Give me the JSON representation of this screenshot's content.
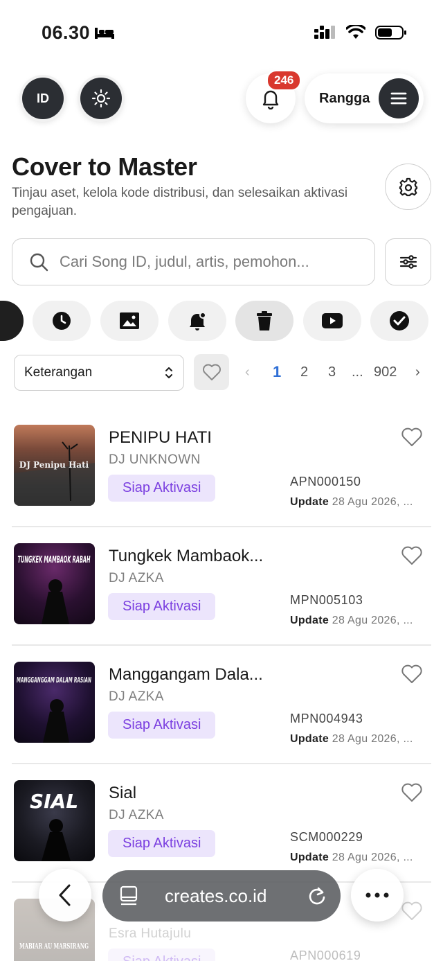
{
  "status_bar": {
    "time": "06.30"
  },
  "header": {
    "language_label": "ID",
    "notification_count": "246",
    "user_name": "Rangga"
  },
  "page": {
    "title": "Cover to Master",
    "subtitle": "Tinjau aset, kelola kode distribusi, dan selesaikan aktivasi pengajuan."
  },
  "search": {
    "placeholder": "Cari Song ID, judul, artis, pemohon..."
  },
  "filter_chips": [
    {
      "icon": "clock-icon"
    },
    {
      "icon": "image-icon"
    },
    {
      "icon": "bell-alert-icon"
    },
    {
      "icon": "trash-icon",
      "active": true
    },
    {
      "icon": "youtube-icon"
    },
    {
      "icon": "check-circle-icon"
    }
  ],
  "sort": {
    "selected": "Keterangan"
  },
  "pagination": {
    "prev": "‹",
    "pages": [
      "1",
      "2",
      "3"
    ],
    "ellipsis": "...",
    "last": "902",
    "next": "›",
    "current": "1"
  },
  "songs": [
    {
      "title": "PENIPU HATI",
      "artist": "DJ UNKNOWN",
      "status": "Siap Aktivasi",
      "code": "APN000150",
      "update_label": "Update",
      "update_value": "28 Agu 2026, ...",
      "cover_text": "DJ Penipu Hati"
    },
    {
      "title": "Tungkek Mambaok...",
      "artist": "DJ AZKA",
      "status": "Siap Aktivasi",
      "code": "MPN005103",
      "update_label": "Update",
      "update_value": "28 Agu 2026, ...",
      "cover_text": "TUNGKEK MAMBAOK RABAH"
    },
    {
      "title": "Manggangam Dala...",
      "artist": "DJ AZKA",
      "status": "Siap Aktivasi",
      "code": "MPN004943",
      "update_label": "Update",
      "update_value": "28 Agu 2026, ...",
      "cover_text": "MANGGANGGAM DALAM RASIAN"
    },
    {
      "title": "Sial",
      "artist": "DJ AZKA",
      "status": "Siap Aktivasi",
      "code": "SCM000229",
      "update_label": "Update",
      "update_value": "28 Agu 2026, ...",
      "cover_text": "SIAL"
    },
    {
      "title": "",
      "artist": "Esra Hutajulu",
      "status": "Siap Aktivasi",
      "code": "APN000619",
      "update_label": "",
      "update_value": "",
      "cover_text": "MABIAR AU MARSIRANG"
    }
  ],
  "browser": {
    "url": "creates.co.id"
  },
  "colors": {
    "accent": "#7b3fe0",
    "badge_bg": "#ece5fc",
    "notification": "#d9382e",
    "page_current": "#2f6fd6"
  }
}
